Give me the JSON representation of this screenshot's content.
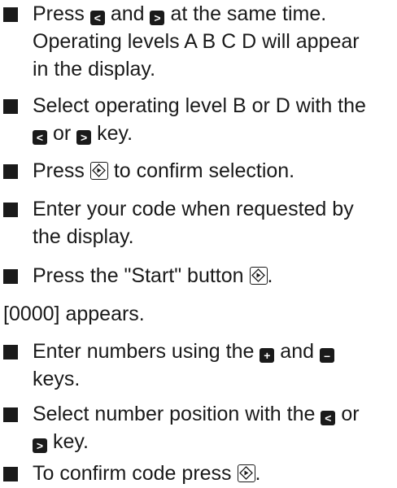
{
  "steps": [
    {
      "parts": [
        "Press",
        "and",
        "at the same time.",
        "Operating levels A B C D will appear",
        "in the display."
      ]
    },
    {
      "parts": [
        "Select operating level B or D with the",
        "or",
        "key."
      ]
    },
    {
      "parts": [
        "Press",
        "to confirm selection."
      ]
    },
    {
      "parts": [
        "Enter your code when requested by",
        "the display."
      ]
    },
    {
      "parts": [
        "Press the \"Start\" button",
        "."
      ]
    },
    {
      "parts": [
        "Enter numbers using the",
        "and",
        "keys."
      ]
    },
    {
      "parts": [
        "Select number position with the",
        "or",
        "key."
      ]
    },
    {
      "parts": [
        "To confirm code press",
        "."
      ]
    }
  ],
  "note": "[0000] appears.",
  "icons": {
    "left": "left-arrow-key-icon",
    "right": "right-arrow-key-icon",
    "start": "start-button-icon",
    "plus": "plus-key-icon",
    "minus": "minus-key-icon"
  }
}
